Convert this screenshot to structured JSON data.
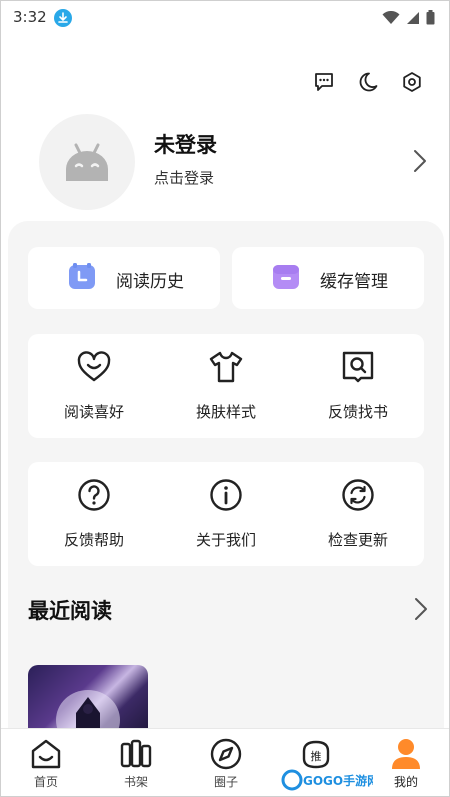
{
  "status_bar": {
    "time": "3:32"
  },
  "colors": {
    "accent_orange": "#ff8a2a",
    "icon_blue": "#6e8ef0",
    "icon_purple": "#a77df0",
    "download_blue": "#29a8e8"
  },
  "top_actions": [
    {
      "icon": "message-icon"
    },
    {
      "icon": "moon-icon"
    },
    {
      "icon": "settings-icon"
    }
  ],
  "profile": {
    "name": "未登录",
    "subtitle": "点击登录"
  },
  "quick_actions": [
    {
      "label": "阅读历史",
      "icon": "clock-icon"
    },
    {
      "label": "缓存管理",
      "icon": "folder-icon"
    }
  ],
  "grid_row_1": [
    {
      "label": "阅读喜好",
      "icon": "heart-icon"
    },
    {
      "label": "换肤样式",
      "icon": "shirt-icon"
    },
    {
      "label": "反馈找书",
      "icon": "book-search-icon"
    }
  ],
  "grid_row_2": [
    {
      "label": "反馈帮助",
      "icon": "help-icon"
    },
    {
      "label": "关于我们",
      "icon": "info-icon"
    },
    {
      "label": "检查更新",
      "icon": "refresh-icon"
    }
  ],
  "recent": {
    "title": "最近阅读"
  },
  "bottom_nav": [
    {
      "label": "首页",
      "icon": "home-icon"
    },
    {
      "label": "书架",
      "icon": "bookshelf-icon"
    },
    {
      "label": "圈子",
      "icon": "compass-icon"
    },
    {
      "label": "推",
      "icon": "recommend-icon"
    },
    {
      "label": "我的",
      "icon": "profile-icon",
      "active": true
    }
  ],
  "watermark": {
    "text": "GOGO手游网"
  }
}
